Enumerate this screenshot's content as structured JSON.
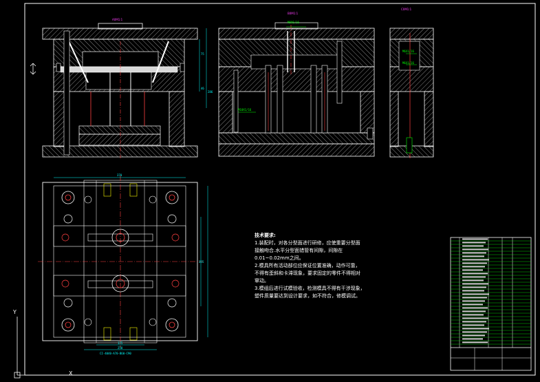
{
  "views": {
    "front_label": "A0M1:1",
    "side_label": "B0M1:1",
    "end_label": "C0M1:1"
  },
  "front_view": {
    "dim_top": "75",
    "dim_mid": "46",
    "dim_total": "286"
  },
  "side_view": {
    "callout_top": "M8X6/16",
    "callout_mid": "M10X1/16"
  },
  "end_view": {
    "callout_a": "M6X1/16",
    "callout_b": "M6X1/16"
  },
  "plan_view": {
    "dim_top": "370",
    "dim_right": "355",
    "dim_bottom_a": "175",
    "dim_bottom_b": "250",
    "designation": "CI-4040-A70-B60-C90"
  },
  "technical_notes": {
    "title": "技术要求:",
    "lines": [
      "1.装配时，对各分型面进行研修，应使重要分型面",
      "接触吻合.水平分型面错管有间隙，间隙在",
      "0.01~0.02mm之间。",
      "2.模具所有活动部位应保证位置准确，动作可靠，",
      "不得有歪斜和卡滞现象，要求固定的零件不得相对",
      "窜动。",
      "3.模组后进行试模验收，检测模具不得有干涉现象，",
      "塑件质量要达到设计要求，如不符合，修模调试。"
    ]
  },
  "ucs": {
    "y_label": "Y",
    "x_label": "X"
  }
}
